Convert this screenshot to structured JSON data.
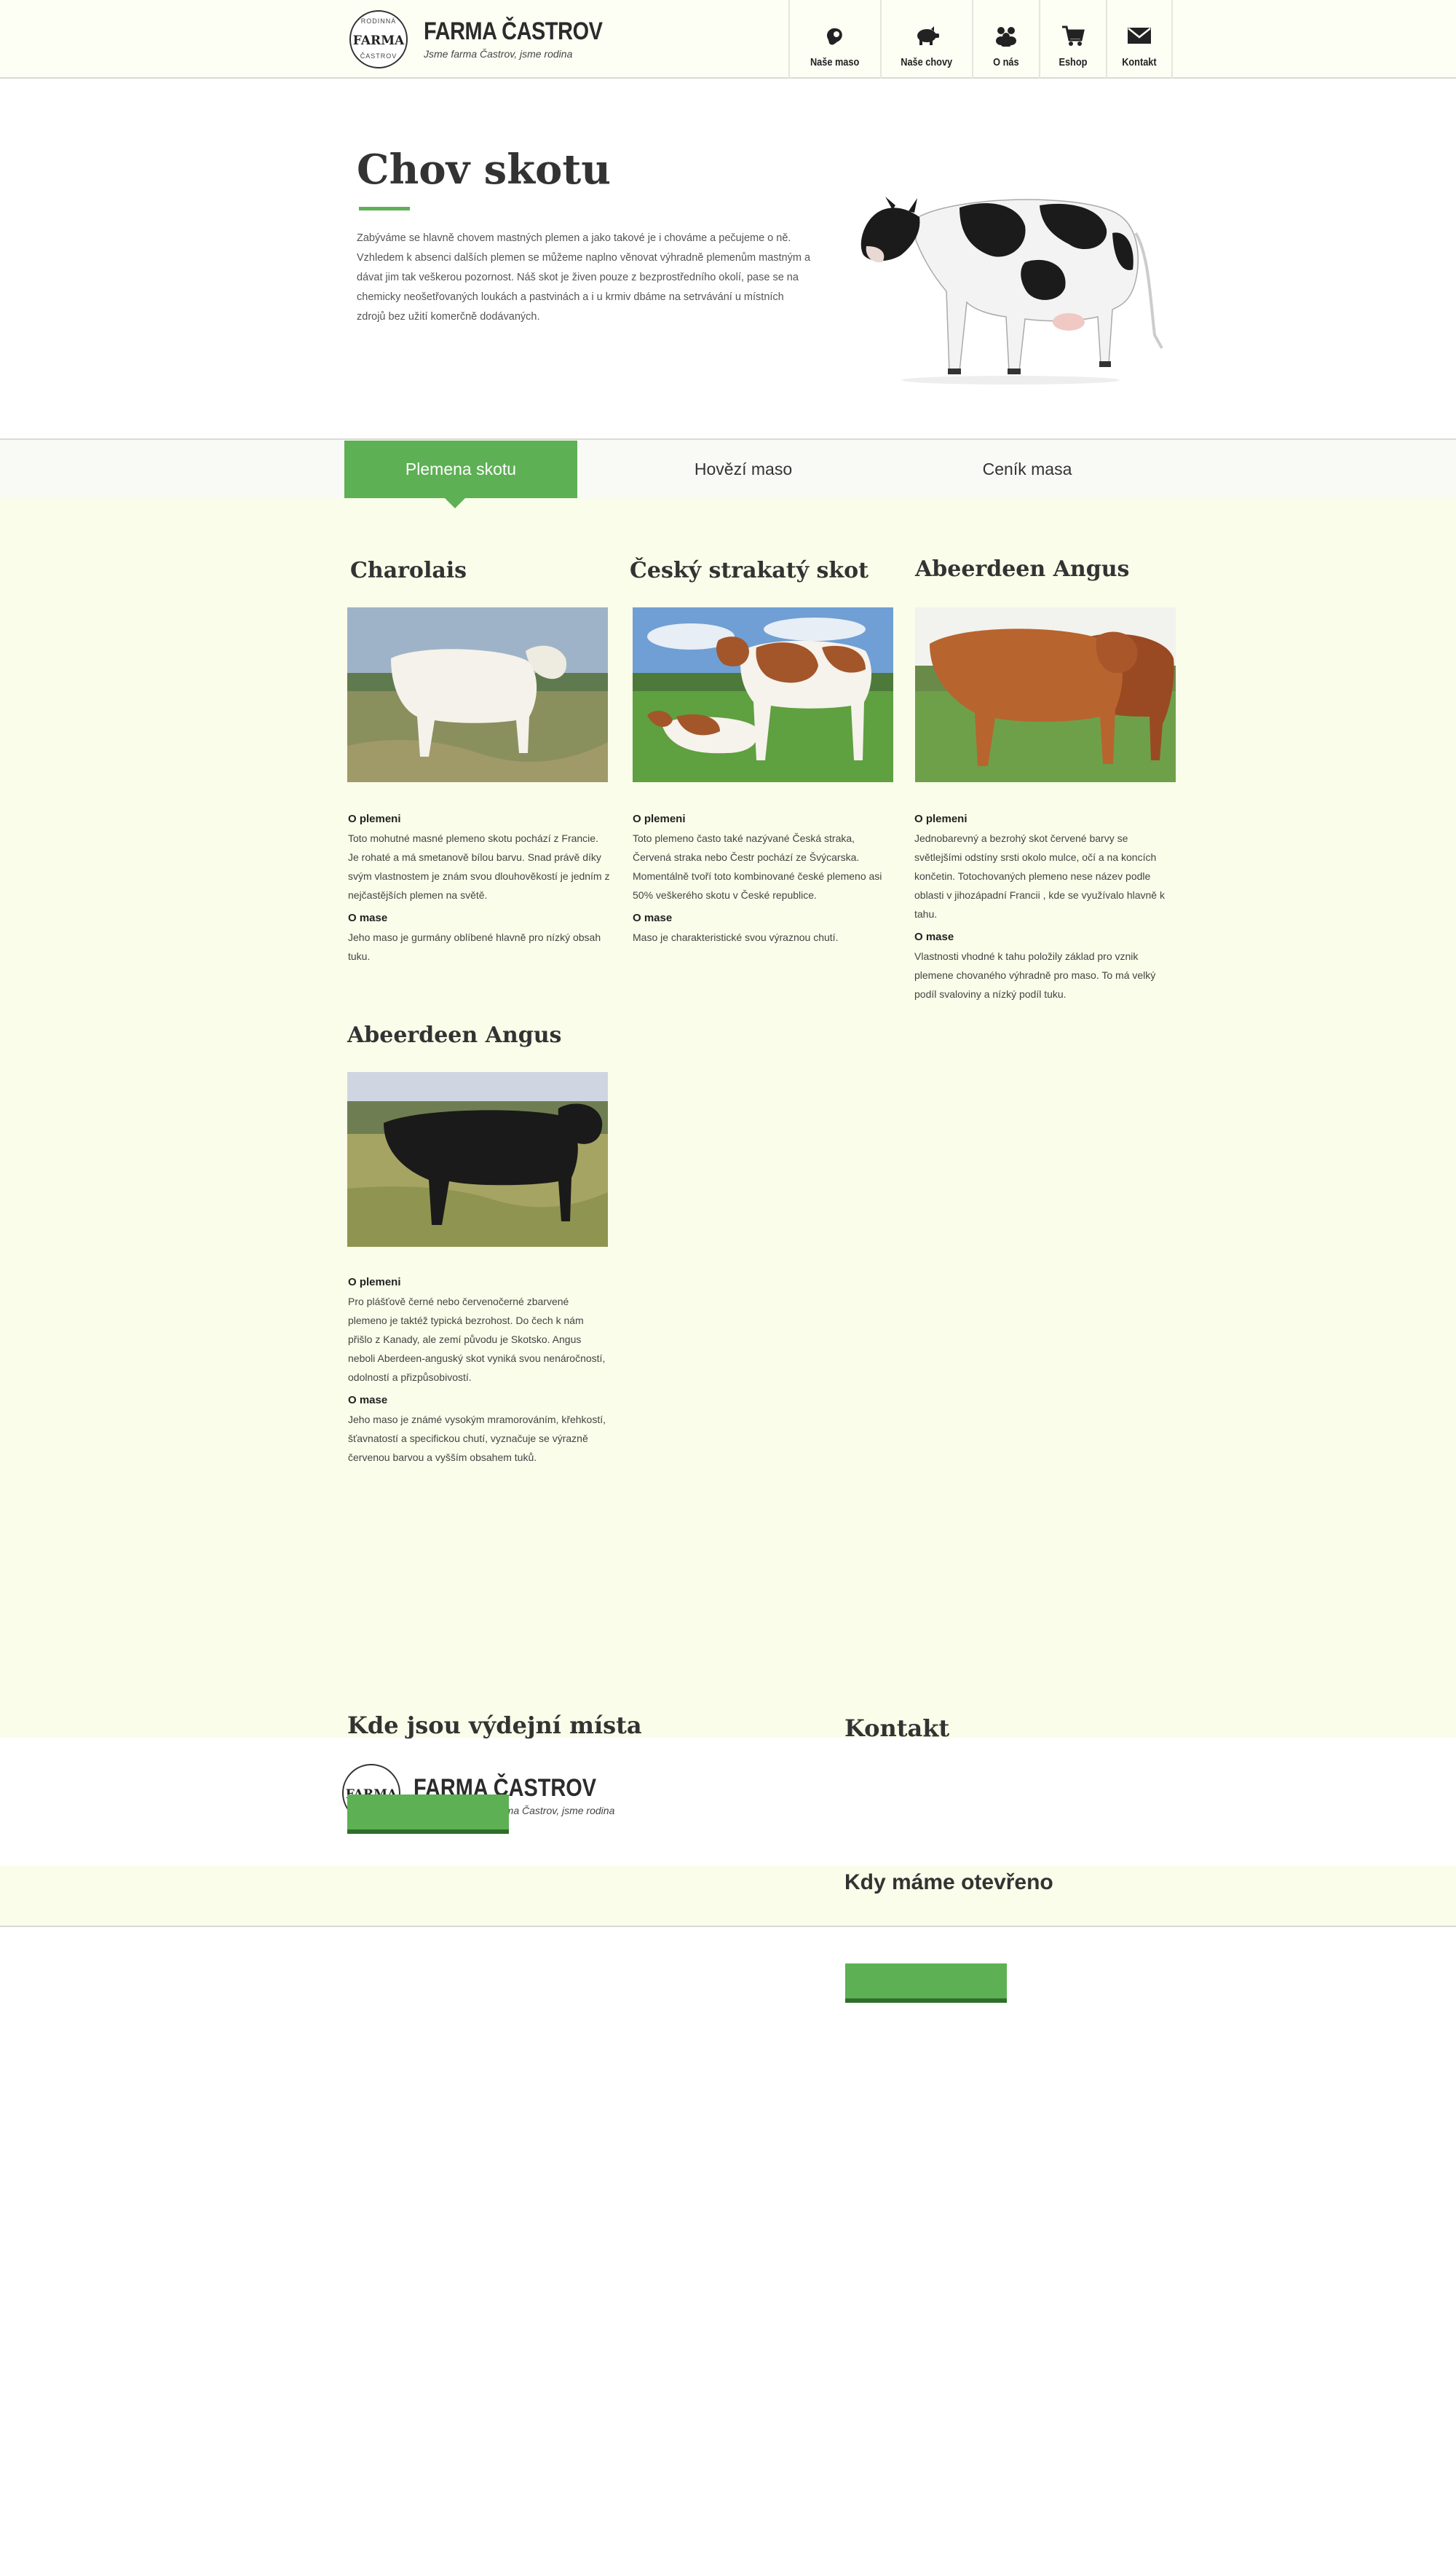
{
  "header": {
    "logo": {
      "top": "RODINNÁ",
      "mid": "FARMA",
      "bottom": "ČASTROV"
    },
    "brand_name": "FARMA ČASTROV",
    "slogan": "Jsme farma Častrov, jsme rodina"
  },
  "nav": [
    {
      "label": "Naše maso",
      "icon": "meat-icon"
    },
    {
      "label": "Naše chovy",
      "icon": "pig-icon"
    },
    {
      "label": "O nás",
      "icon": "people-icon"
    },
    {
      "label": "Eshop",
      "icon": "cart-icon"
    },
    {
      "label": "Kontakt",
      "icon": "envelope-icon"
    }
  ],
  "intro": {
    "title": "Chov skotu",
    "text": "Zabýváme se hlavně chovem mastných plemen a jako takové je i chováme a pečujeme o ně. Vzhledem k absenci dalších plemen se můžeme naplno věnovat výhradně plemenům mastným a dávat jim tak veškerou pozornost. Náš skot je živen pouze z bezprostředního okolí, pase se na chemicky neošetřovaných loukách a pastvinách a i u krmiv dbáme na setrvávání u místních zdrojů bez užití komerčně dodávaných."
  },
  "tabs": [
    {
      "label": "Plemena skotu",
      "active": true
    },
    {
      "label": "Hovězí maso",
      "active": false
    },
    {
      "label": "Ceník masa",
      "active": false
    }
  ],
  "breeds": [
    {
      "name": "Charolais",
      "about_heading": "O plemeni",
      "about": "Toto mohutné masné plemeno skotu pochází z Francie. Je rohaté a má smetanově bílou barvu. Snad právě díky svým vlastnostem je znám svou dlouhověkostí je jedním z nejčastějších plemen na světě.",
      "meat_heading": "O mase",
      "meat": "Jeho maso je gurmány oblíbené hlavně pro nízký obsah tuku."
    },
    {
      "name": "Český strakatý skot",
      "about_heading": "O plemeni",
      "about": "Toto plemeno často také nazývané Česká straka, Červená straka nebo Čestr pochází ze Švýcarska. Momentálně tvoří toto kombinované české plemeno asi 50% veškerého skotu v České republice.",
      "meat_heading": "O mase",
      "meat": "Maso je charakteristické svou výraznou chutí."
    },
    {
      "name": "Abeerdeen Angus",
      "about_heading": "O plemeni",
      "about": "Jednobarevný a bezrohý skot červené barvy se světlejšími odstíny srsti okolo mulce, očí a na koncích končetin. Totochovaných plemeno nese název podle oblasti v jihozápadní Francii , kde se využívalo hlavně k tahu.",
      "meat_heading": "O mase",
      "meat": "Vlastnosti vhodné k tahu položily základ pro vznik plemene chovaného výhradně pro maso. To má velký podíl svaloviny a nízký podíl tuku."
    },
    {
      "name": "Abeerdeen Angus",
      "about_heading": "O plemeni",
      "about": "Pro plášťově černé nebo červenočerné zbarvené plemeno je taktéž typická bezrohost. Do čech k nám přišlo z Kanady, ale zemí původu je Skotsko. Angus neboli Aberdeen-anguský skot vyniká svou nenáročností, odolností a přizpůsobivostí.",
      "meat_heading": "O mase",
      "meat": "Jeho maso je známé vysokým mramorováním, křehkostí, šťavnatostí a specifickou chutí, vyznačuje se výrazně červenou barvou a vyšším obsahem tuků."
    }
  ],
  "footer": {
    "pickup_title": "Kde jsou výdejní místa",
    "contact_title": "Kontakt",
    "hours_title": "Kdy máme otevřeno",
    "brand_name": "FARMA ČASTROV",
    "logo_mid": "FARMA",
    "slogan": "Jsme farma Častrov, jsme rodina"
  },
  "colors": {
    "accent": "#5db054",
    "accent_dark": "#2f6e2a",
    "header_bg": "#fdfef4",
    "main_bg": "#f9fde9"
  }
}
